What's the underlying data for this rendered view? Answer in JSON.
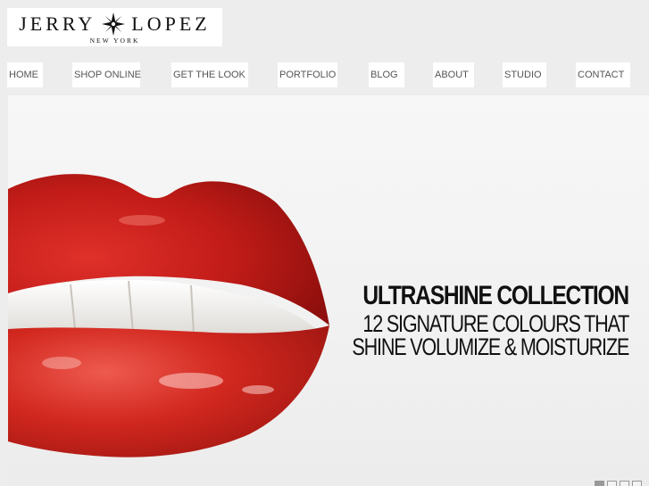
{
  "brand": {
    "name_left": "JERRY",
    "name_right": "LOPEZ",
    "tagline": "NEW YORK",
    "logo_icon": "star-icon"
  },
  "nav": {
    "items": [
      {
        "label": "HOME"
      },
      {
        "label": "SHOP ONLINE"
      },
      {
        "label": "GET THE LOOK"
      },
      {
        "label": "PORTFOLIO"
      },
      {
        "label": "BLOG"
      },
      {
        "label": "ABOUT"
      },
      {
        "label": "STUDIO"
      },
      {
        "label": "CONTACT"
      }
    ]
  },
  "hero": {
    "title": "ULTRASHINE COLLECTION",
    "line1": "12 SIGNATURE COLOURS THAT",
    "line2": "SHINE VOLUMIZE & MOISTURIZE",
    "slide_count": 4,
    "active_slide": 1,
    "image_subject": "red glossy lips"
  },
  "colors": {
    "background": "#ededed",
    "lip_red": "#d8241e",
    "text": "#111111"
  }
}
